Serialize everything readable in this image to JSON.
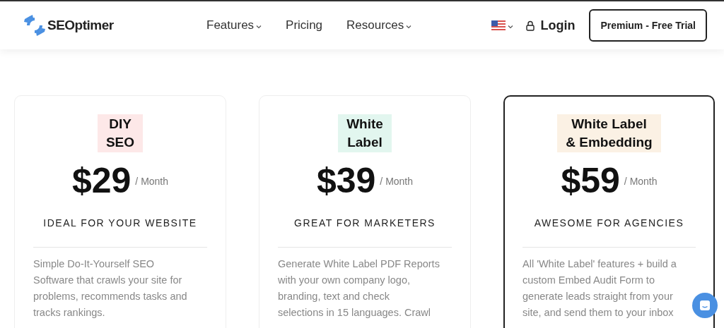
{
  "header": {
    "logo": "SEOptimer",
    "nav": [
      {
        "label": "Features",
        "dropdown": true
      },
      {
        "label": "Pricing",
        "dropdown": false
      },
      {
        "label": "Resources",
        "dropdown": true
      }
    ],
    "login": "Login",
    "cta": "Premium - Free Trial"
  },
  "plans": [
    {
      "name_lines": [
        "DIY",
        "SEO"
      ],
      "color": "#fde8e8",
      "price": "$29",
      "period": "/ Month",
      "tagline": "IDEAL FOR YOUR WEBSITE",
      "selected": false,
      "description_lines": [
        "Simple Do-It-Yourself SEO",
        "Software that crawls your site for",
        "problems, recommends tasks and",
        "tracks rankings."
      ]
    },
    {
      "name_lines": [
        "White",
        "Label"
      ],
      "color": "#e2f6ef",
      "price": "$39",
      "period": "/ Month",
      "tagline": "GREAT FOR MARKETERS",
      "selected": false,
      "description_lines": [
        "Generate White Label PDF Reports",
        "with your own company logo,",
        "branding, text and check",
        "selections in 15 languages. Crawl"
      ]
    },
    {
      "name_lines": [
        "White Label",
        "& Embedding"
      ],
      "color": "#fbf1e4",
      "price": "$59",
      "period": "/ Month",
      "tagline": "AWESOME FOR AGENCIES",
      "selected": true,
      "description_lines": [
        "All 'White Label' features + build a",
        "custom Embed Audit Form to",
        "generate leads straight from your",
        "site, and send them to your inbox"
      ]
    }
  ]
}
